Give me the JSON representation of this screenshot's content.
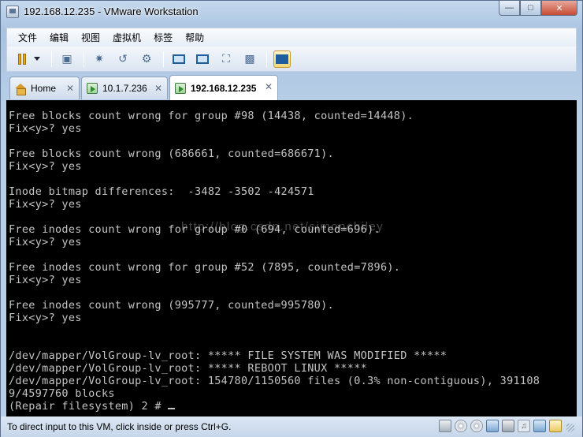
{
  "window": {
    "title": "192.168.12.235 - VMware Workstation"
  },
  "menubar": {
    "items": [
      "文件",
      "编辑",
      "视图",
      "虚拟机",
      "标签",
      "帮助"
    ]
  },
  "toolbar": {
    "icons": [
      "pause-icon",
      "send-ctrl-alt-del-icon",
      "snapshot-icon",
      "revert-snapshot-icon",
      "snapshot-manager-icon",
      "console-view-icon",
      "fullscreen-icon",
      "stretch-icon",
      "unity-icon",
      "quick-switch-icon"
    ]
  },
  "tabs": [
    {
      "label": "Home",
      "icon": "home-icon",
      "active": false
    },
    {
      "label": "10.1.7.236",
      "icon": "vm-icon",
      "active": false
    },
    {
      "label": "192.168.12.235",
      "icon": "vm-icon",
      "active": true
    }
  ],
  "console": {
    "lines": [
      "Free blocks count wrong for group #98 (14438, counted=14448).",
      "Fix<y>? yes",
      "",
      "Free blocks count wrong (686661, counted=686671).",
      "Fix<y>? yes",
      "",
      "Inode bitmap differences:  -3482 -3502 -424571",
      "Fix<y>? yes",
      "",
      "Free inodes count wrong for group #0 (694, counted=696).",
      "Fix<y>? yes",
      "",
      "Free inodes count wrong for group #52 (7895, counted=7896).",
      "Fix<y>? yes",
      "",
      "Free inodes count wrong (995777, counted=995780).",
      "Fix<y>? yes",
      "",
      "",
      "/dev/mapper/VolGroup-lv_root: ***** FILE SYSTEM WAS MODIFIED *****",
      "/dev/mapper/VolGroup-lv_root: ***** REBOOT LINUX *****",
      "/dev/mapper/VolGroup-lv_root: 154780/1150560 files (0.3% non-contiguous), 391108",
      "9/4597760 blocks",
      "(Repair filesystem) 2 # "
    ],
    "watermark": "http://blog.csdn.net/simonchiley"
  },
  "statusbar": {
    "text": "To direct input to this VM, click inside or press Ctrl+G."
  }
}
